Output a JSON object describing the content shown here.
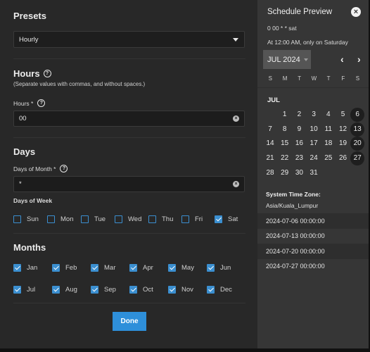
{
  "form": {
    "presets": {
      "title": "Presets",
      "selected": "Hourly"
    },
    "hours": {
      "title": "Hours",
      "hint": "(Separate values with commas, and without spaces.)",
      "field_label": "Hours *",
      "value": "00"
    },
    "days": {
      "title": "Days",
      "month_label": "Days of Month *",
      "month_value": "*",
      "week_label": "Days of Week",
      "week": [
        {
          "label": "Sun",
          "checked": false
        },
        {
          "label": "Mon",
          "checked": false
        },
        {
          "label": "Tue",
          "checked": false
        },
        {
          "label": "Wed",
          "checked": false
        },
        {
          "label": "Thu",
          "checked": false
        },
        {
          "label": "Fri",
          "checked": false
        },
        {
          "label": "Sat",
          "checked": true
        }
      ]
    },
    "months": {
      "title": "Months",
      "items": [
        {
          "label": "Jan",
          "checked": true
        },
        {
          "label": "Feb",
          "checked": true
        },
        {
          "label": "Mar",
          "checked": true
        },
        {
          "label": "Apr",
          "checked": true
        },
        {
          "label": "May",
          "checked": true
        },
        {
          "label": "Jun",
          "checked": true
        },
        {
          "label": "Jul",
          "checked": true
        },
        {
          "label": "Aug",
          "checked": true
        },
        {
          "label": "Sep",
          "checked": true
        },
        {
          "label": "Oct",
          "checked": true
        },
        {
          "label": "Nov",
          "checked": true
        },
        {
          "label": "Dec",
          "checked": true
        }
      ]
    },
    "done_label": "Done"
  },
  "preview": {
    "title": "Schedule Preview",
    "cron": "0 00 * * sat",
    "description": "At 12:00 AM, only on Saturday",
    "month_year": "JUL 2024",
    "weekday_headers": [
      "S",
      "M",
      "T",
      "W",
      "T",
      "F",
      "S"
    ],
    "month_label": "JUL",
    "first_weekday_offset": 1,
    "days_in_month": 31,
    "selected_days": [
      6,
      13,
      20,
      27
    ],
    "timezone_label": "System Time Zone:",
    "timezone": "Asia/Kuala_Lumpur",
    "runs": [
      "2024-07-06 00:00:00",
      "2024-07-13 00:00:00",
      "2024-07-20 00:00:00",
      "2024-07-27 00:00:00"
    ]
  },
  "colors": {
    "accent": "#2e8fda",
    "checkbox": "#3b8fd0"
  }
}
